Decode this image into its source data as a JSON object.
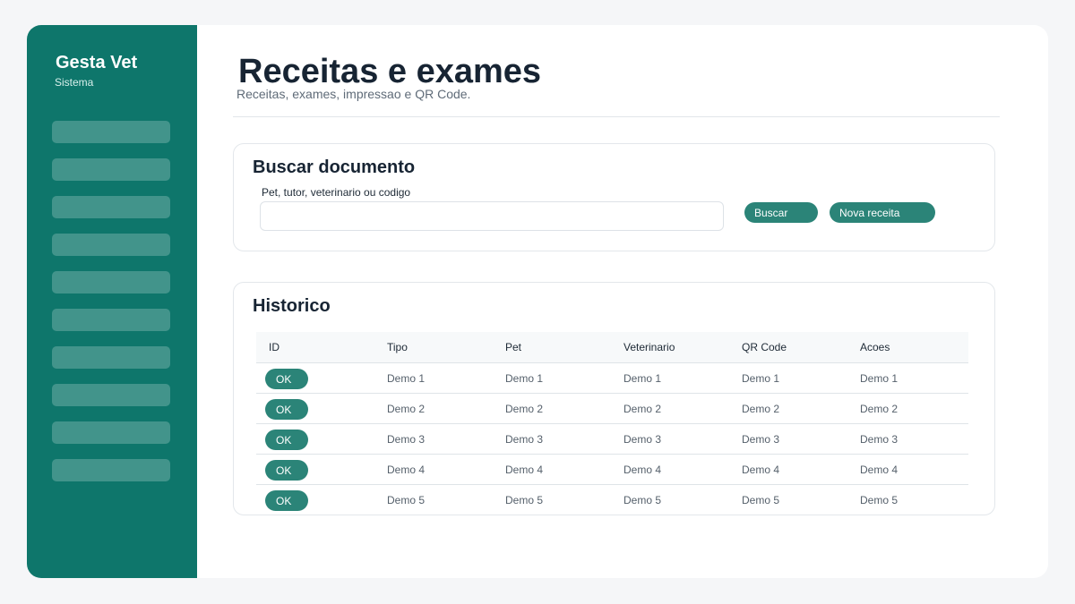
{
  "app": {
    "name": "Gesta Vet",
    "subtitle": "Sistema"
  },
  "page": {
    "title": "Receitas e exames",
    "subtitle": "Receitas, exames, impressao e QR Code."
  },
  "search": {
    "title": "Buscar documento",
    "field_label": "Pet, tutor, veterinario ou codigo",
    "value": "",
    "search_button": "Buscar",
    "new_button": "Nova receita"
  },
  "history": {
    "title": "Historico",
    "columns": [
      "ID",
      "Tipo",
      "Pet",
      "Veterinario",
      "QR Code",
      "Acoes"
    ],
    "rows": [
      {
        "id": "OK",
        "tipo": "Demo 1",
        "pet": "Demo 1",
        "veterinario": "Demo 1",
        "qr": "Demo 1",
        "acoes": "Demo 1"
      },
      {
        "id": "OK",
        "tipo": "Demo 2",
        "pet": "Demo 2",
        "veterinario": "Demo 2",
        "qr": "Demo 2",
        "acoes": "Demo 2"
      },
      {
        "id": "OK",
        "tipo": "Demo 3",
        "pet": "Demo 3",
        "veterinario": "Demo 3",
        "qr": "Demo 3",
        "acoes": "Demo 3"
      },
      {
        "id": "OK",
        "tipo": "Demo 4",
        "pet": "Demo 4",
        "veterinario": "Demo 4",
        "qr": "Demo 4",
        "acoes": "Demo 4"
      },
      {
        "id": "OK",
        "tipo": "Demo 5",
        "pet": "Demo 5",
        "veterinario": "Demo 5",
        "qr": "Demo 5",
        "acoes": "Demo 5"
      }
    ]
  },
  "colors": {
    "sidebar": "#0e766b",
    "accent": "#2b8478",
    "text_dark": "#172433",
    "background": "#f5f6f8"
  }
}
